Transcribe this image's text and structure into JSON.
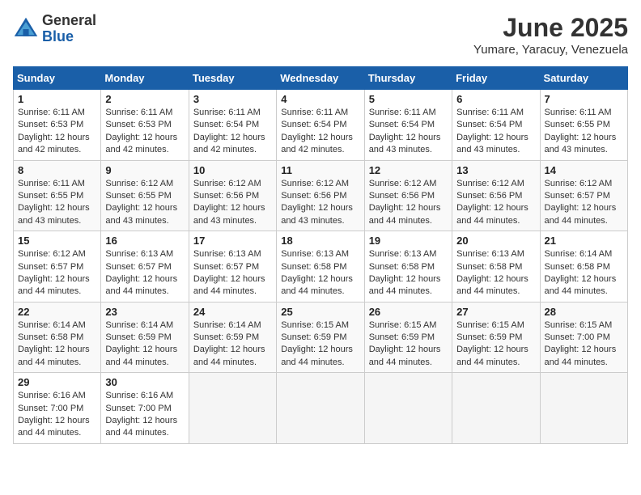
{
  "header": {
    "logo_general": "General",
    "logo_blue": "Blue",
    "month": "June 2025",
    "location": "Yumare, Yaracuy, Venezuela"
  },
  "columns": [
    "Sunday",
    "Monday",
    "Tuesday",
    "Wednesday",
    "Thursday",
    "Friday",
    "Saturday"
  ],
  "weeks": [
    [
      {
        "day": "1",
        "sunrise": "Sunrise: 6:11 AM",
        "sunset": "Sunset: 6:53 PM",
        "daylight": "Daylight: 12 hours and 42 minutes."
      },
      {
        "day": "2",
        "sunrise": "Sunrise: 6:11 AM",
        "sunset": "Sunset: 6:53 PM",
        "daylight": "Daylight: 12 hours and 42 minutes."
      },
      {
        "day": "3",
        "sunrise": "Sunrise: 6:11 AM",
        "sunset": "Sunset: 6:54 PM",
        "daylight": "Daylight: 12 hours and 42 minutes."
      },
      {
        "day": "4",
        "sunrise": "Sunrise: 6:11 AM",
        "sunset": "Sunset: 6:54 PM",
        "daylight": "Daylight: 12 hours and 42 minutes."
      },
      {
        "day": "5",
        "sunrise": "Sunrise: 6:11 AM",
        "sunset": "Sunset: 6:54 PM",
        "daylight": "Daylight: 12 hours and 43 minutes."
      },
      {
        "day": "6",
        "sunrise": "Sunrise: 6:11 AM",
        "sunset": "Sunset: 6:54 PM",
        "daylight": "Daylight: 12 hours and 43 minutes."
      },
      {
        "day": "7",
        "sunrise": "Sunrise: 6:11 AM",
        "sunset": "Sunset: 6:55 PM",
        "daylight": "Daylight: 12 hours and 43 minutes."
      }
    ],
    [
      {
        "day": "8",
        "sunrise": "Sunrise: 6:11 AM",
        "sunset": "Sunset: 6:55 PM",
        "daylight": "Daylight: 12 hours and 43 minutes."
      },
      {
        "day": "9",
        "sunrise": "Sunrise: 6:12 AM",
        "sunset": "Sunset: 6:55 PM",
        "daylight": "Daylight: 12 hours and 43 minutes."
      },
      {
        "day": "10",
        "sunrise": "Sunrise: 6:12 AM",
        "sunset": "Sunset: 6:56 PM",
        "daylight": "Daylight: 12 hours and 43 minutes."
      },
      {
        "day": "11",
        "sunrise": "Sunrise: 6:12 AM",
        "sunset": "Sunset: 6:56 PM",
        "daylight": "Daylight: 12 hours and 43 minutes."
      },
      {
        "day": "12",
        "sunrise": "Sunrise: 6:12 AM",
        "sunset": "Sunset: 6:56 PM",
        "daylight": "Daylight: 12 hours and 44 minutes."
      },
      {
        "day": "13",
        "sunrise": "Sunrise: 6:12 AM",
        "sunset": "Sunset: 6:56 PM",
        "daylight": "Daylight: 12 hours and 44 minutes."
      },
      {
        "day": "14",
        "sunrise": "Sunrise: 6:12 AM",
        "sunset": "Sunset: 6:57 PM",
        "daylight": "Daylight: 12 hours and 44 minutes."
      }
    ],
    [
      {
        "day": "15",
        "sunrise": "Sunrise: 6:12 AM",
        "sunset": "Sunset: 6:57 PM",
        "daylight": "Daylight: 12 hours and 44 minutes."
      },
      {
        "day": "16",
        "sunrise": "Sunrise: 6:13 AM",
        "sunset": "Sunset: 6:57 PM",
        "daylight": "Daylight: 12 hours and 44 minutes."
      },
      {
        "day": "17",
        "sunrise": "Sunrise: 6:13 AM",
        "sunset": "Sunset: 6:57 PM",
        "daylight": "Daylight: 12 hours and 44 minutes."
      },
      {
        "day": "18",
        "sunrise": "Sunrise: 6:13 AM",
        "sunset": "Sunset: 6:58 PM",
        "daylight": "Daylight: 12 hours and 44 minutes."
      },
      {
        "day": "19",
        "sunrise": "Sunrise: 6:13 AM",
        "sunset": "Sunset: 6:58 PM",
        "daylight": "Daylight: 12 hours and 44 minutes."
      },
      {
        "day": "20",
        "sunrise": "Sunrise: 6:13 AM",
        "sunset": "Sunset: 6:58 PM",
        "daylight": "Daylight: 12 hours and 44 minutes."
      },
      {
        "day": "21",
        "sunrise": "Sunrise: 6:14 AM",
        "sunset": "Sunset: 6:58 PM",
        "daylight": "Daylight: 12 hours and 44 minutes."
      }
    ],
    [
      {
        "day": "22",
        "sunrise": "Sunrise: 6:14 AM",
        "sunset": "Sunset: 6:58 PM",
        "daylight": "Daylight: 12 hours and 44 minutes."
      },
      {
        "day": "23",
        "sunrise": "Sunrise: 6:14 AM",
        "sunset": "Sunset: 6:59 PM",
        "daylight": "Daylight: 12 hours and 44 minutes."
      },
      {
        "day": "24",
        "sunrise": "Sunrise: 6:14 AM",
        "sunset": "Sunset: 6:59 PM",
        "daylight": "Daylight: 12 hours and 44 minutes."
      },
      {
        "day": "25",
        "sunrise": "Sunrise: 6:15 AM",
        "sunset": "Sunset: 6:59 PM",
        "daylight": "Daylight: 12 hours and 44 minutes."
      },
      {
        "day": "26",
        "sunrise": "Sunrise: 6:15 AM",
        "sunset": "Sunset: 6:59 PM",
        "daylight": "Daylight: 12 hours and 44 minutes."
      },
      {
        "day": "27",
        "sunrise": "Sunrise: 6:15 AM",
        "sunset": "Sunset: 6:59 PM",
        "daylight": "Daylight: 12 hours and 44 minutes."
      },
      {
        "day": "28",
        "sunrise": "Sunrise: 6:15 AM",
        "sunset": "Sunset: 7:00 PM",
        "daylight": "Daylight: 12 hours and 44 minutes."
      }
    ],
    [
      {
        "day": "29",
        "sunrise": "Sunrise: 6:16 AM",
        "sunset": "Sunset: 7:00 PM",
        "daylight": "Daylight: 12 hours and 44 minutes."
      },
      {
        "day": "30",
        "sunrise": "Sunrise: 6:16 AM",
        "sunset": "Sunset: 7:00 PM",
        "daylight": "Daylight: 12 hours and 44 minutes."
      },
      null,
      null,
      null,
      null,
      null
    ]
  ]
}
